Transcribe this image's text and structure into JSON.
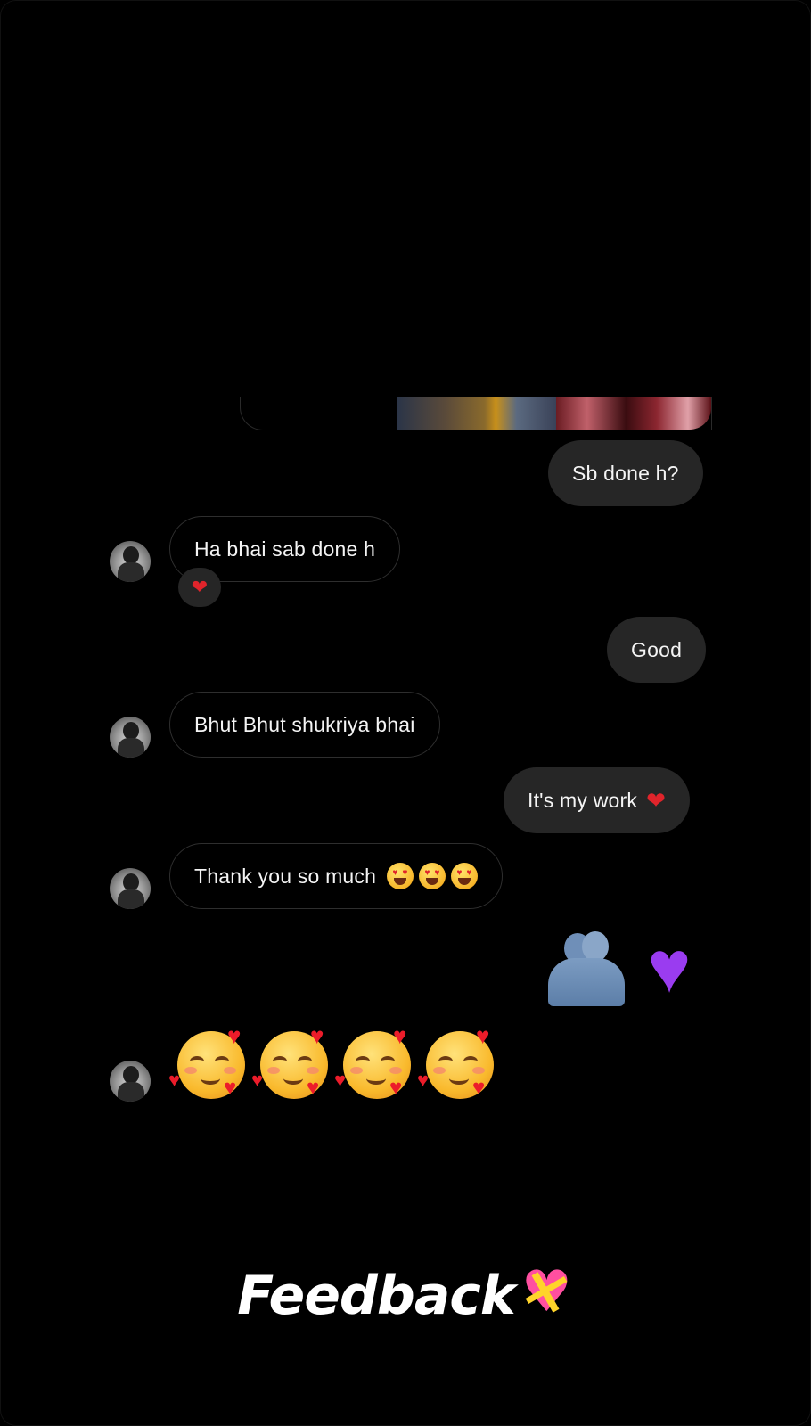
{
  "messages": {
    "m1": {
      "text": "Sb done h?",
      "direction": "outgoing"
    },
    "m2": {
      "text": "Ha bhai sab done h",
      "direction": "incoming",
      "reaction": "heart"
    },
    "m3": {
      "text": "Good",
      "direction": "outgoing"
    },
    "m4": {
      "text": "Bhut Bhut shukriya bhai",
      "direction": "incoming"
    },
    "m5": {
      "text": "It's my work",
      "direction": "outgoing",
      "emoji": "red-heart"
    },
    "m6": {
      "text": "Thank you so much",
      "direction": "incoming",
      "emoji": [
        "heart-eyes-face",
        "heart-eyes-face",
        "heart-eyes-face"
      ]
    },
    "m7": {
      "direction": "outgoing",
      "emoji": [
        "people-hugging",
        "purple-heart"
      ]
    },
    "m8": {
      "direction": "incoming",
      "emoji": [
        "smiling-face-with-hearts",
        "smiling-face-with-hearts",
        "smiling-face-with-hearts",
        "smiling-face-with-hearts"
      ]
    }
  },
  "overlay": {
    "caption": "Feedback",
    "caption_emoji": "heart-with-ribbon"
  },
  "colors": {
    "background": "#000000",
    "outgoing_bubble": "#262626",
    "incoming_border": "#2e2e2e",
    "heart": "#e0242b",
    "purple_heart": "#9a3cf0"
  }
}
